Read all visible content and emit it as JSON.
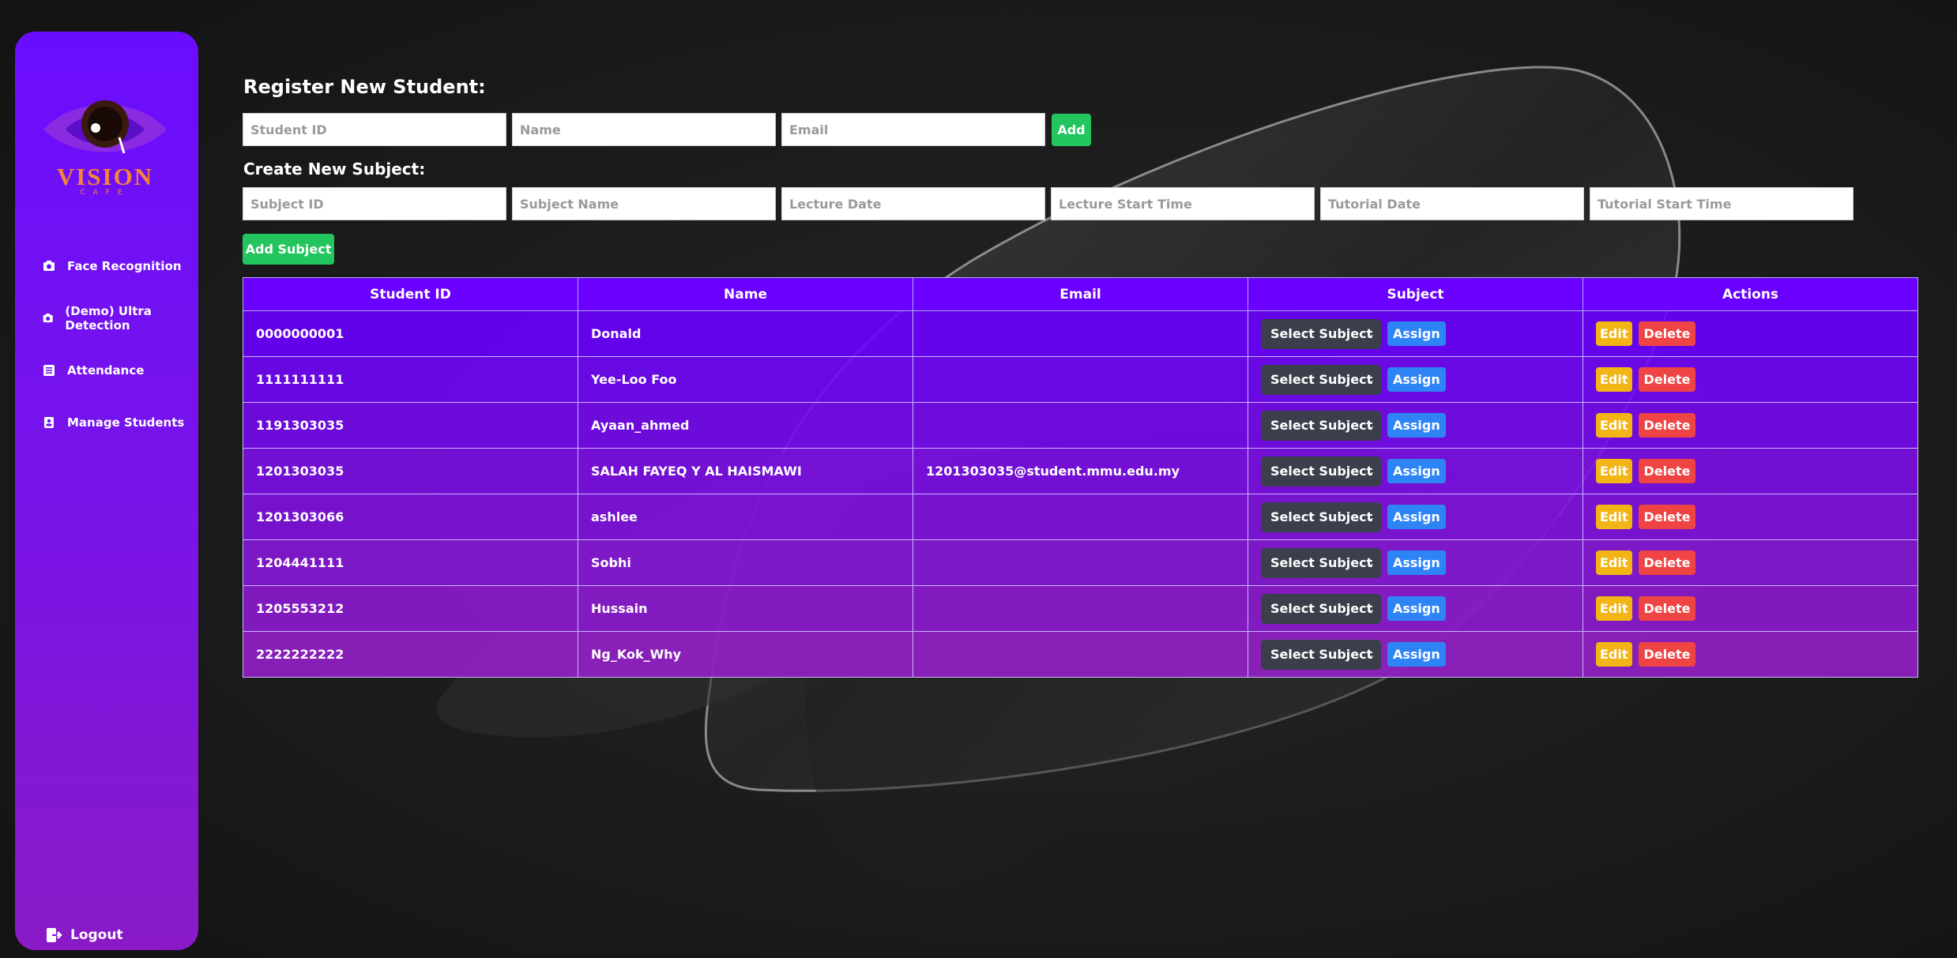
{
  "sidebar": {
    "logo_text": "VISION",
    "logo_subtext": "CAFE",
    "items": [
      {
        "label": "Face Recognition",
        "icon": "camera-icon"
      },
      {
        "label": "(Demo) Ultra Detection",
        "icon": "camera-icon"
      },
      {
        "label": "Attendance",
        "icon": "list-icon"
      },
      {
        "label": "Manage Students",
        "icon": "id-card-icon"
      }
    ],
    "logout_label": "Logout"
  },
  "register": {
    "heading": "Register New Student:",
    "student_id_placeholder": "Student ID",
    "name_placeholder": "Name",
    "email_placeholder": "Email",
    "add_label": "Add"
  },
  "subject": {
    "heading": "Create New Subject:",
    "subject_id_placeholder": "Subject ID",
    "subject_name_placeholder": "Subject Name",
    "lecture_date_placeholder": "Lecture Date",
    "lecture_start_placeholder": "Lecture Start Time",
    "tutorial_date_placeholder": "Tutorial Date",
    "tutorial_start_placeholder": "Tutorial Start Time",
    "add_label": "Add Subject"
  },
  "table": {
    "headers": [
      "Student ID",
      "Name",
      "Email",
      "Subject",
      "Actions"
    ],
    "select_label": "Select Subject",
    "assign_label": "Assign",
    "edit_label": "Edit",
    "delete_label": "Delete",
    "rows": [
      {
        "id": "0000000001",
        "name": "Donald",
        "email": ""
      },
      {
        "id": "1111111111",
        "name": "Yee-Loo Foo",
        "email": ""
      },
      {
        "id": "1191303035",
        "name": "Ayaan_ahmed",
        "email": ""
      },
      {
        "id": "1201303035",
        "name": "SALAH FAYEQ Y AL HAISMAWI",
        "email": "1201303035@student.mmu.edu.my"
      },
      {
        "id": "1201303066",
        "name": "ashlee",
        "email": ""
      },
      {
        "id": "1204441111",
        "name": "Sobhi",
        "email": ""
      },
      {
        "id": "1205553212",
        "name": "Hussain",
        "email": ""
      },
      {
        "id": "2222222222",
        "name": "Ng_Kok_Why",
        "email": ""
      }
    ]
  },
  "colors": {
    "accent_purple": "#6a00ff",
    "add_green": "#22c55e",
    "assign_blue": "#2f84f5",
    "edit_yellow": "#f2b515",
    "delete_red": "#ef4444",
    "logo_orange": "#f4833c"
  }
}
